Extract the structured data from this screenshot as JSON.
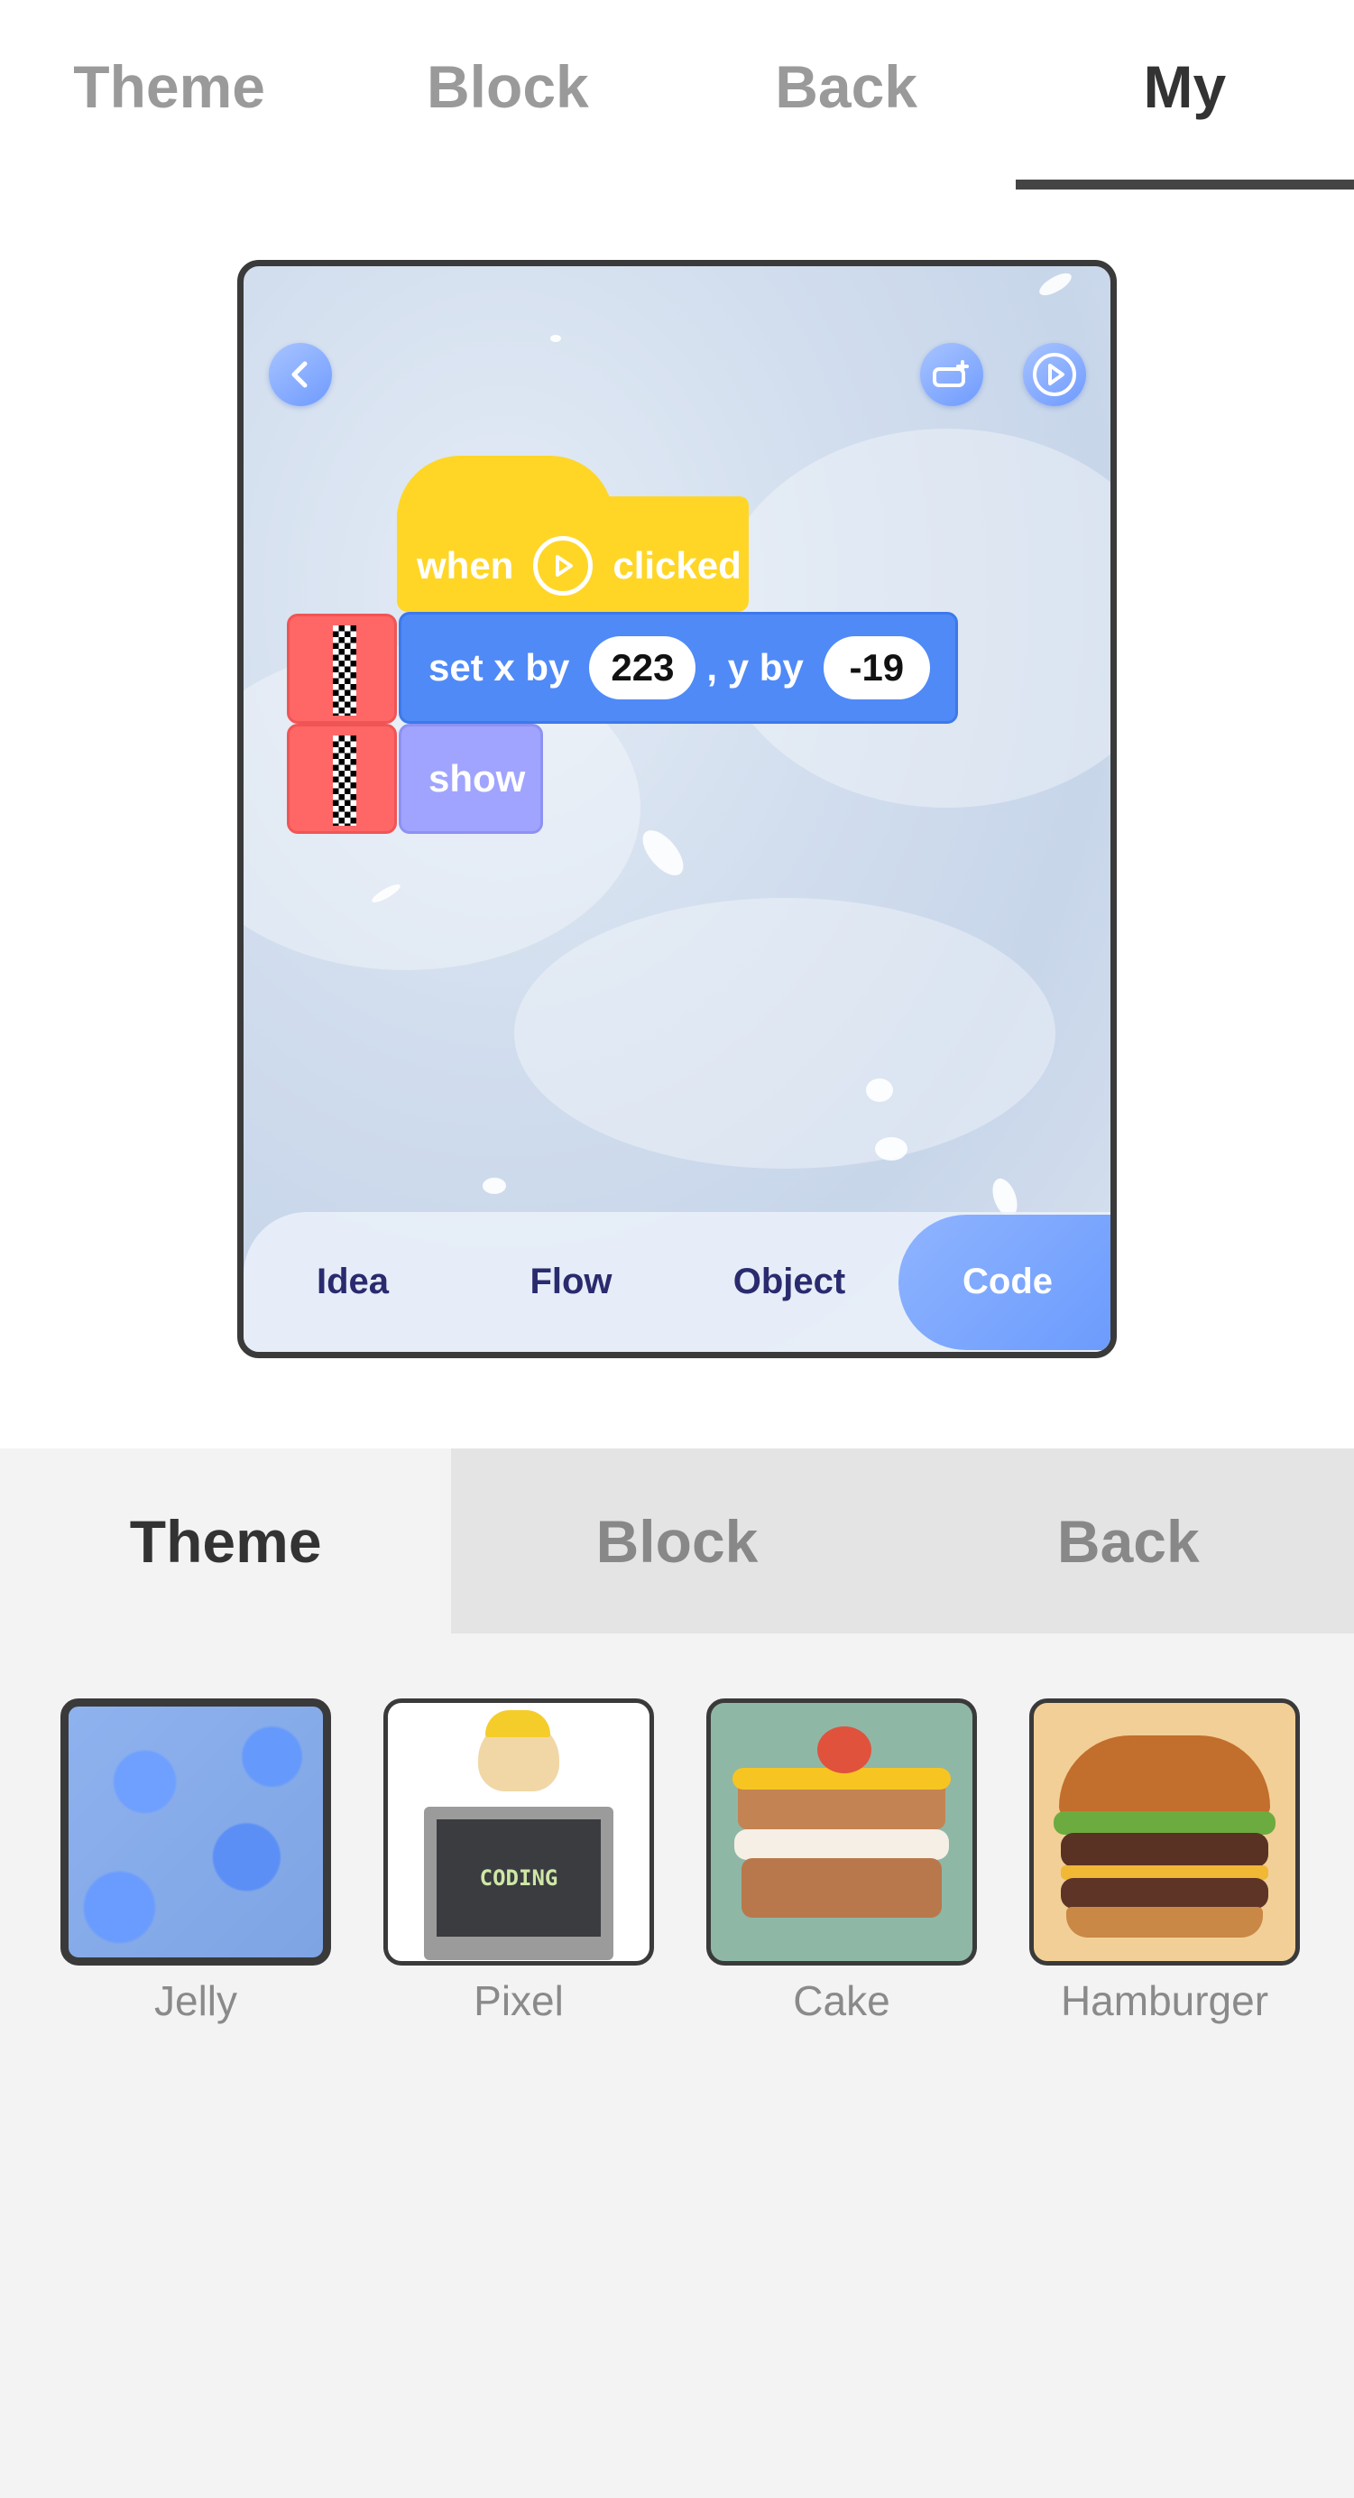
{
  "top_tabs": [
    {
      "label": "Theme"
    },
    {
      "label": "Block"
    },
    {
      "label": "Back"
    },
    {
      "label": "My",
      "active": true
    }
  ],
  "preview": {
    "icons": {
      "back": "chevron-left-icon",
      "stage": "stage-add-icon",
      "play": "play-icon"
    },
    "hat_block": {
      "before": "when",
      "icon": "play-icon",
      "after": "clicked"
    },
    "motion_block": {
      "label1": "set x by",
      "x_value": "223",
      "label2": ", y by",
      "y_value": "-19"
    },
    "looks_block": {
      "label": "show"
    },
    "bottom_tabs": [
      {
        "label": "Idea"
      },
      {
        "label": "Flow"
      },
      {
        "label": "Object"
      },
      {
        "label": "Code",
        "active": true
      }
    ]
  },
  "lower_tabs": [
    {
      "label": "Theme",
      "active": true
    },
    {
      "label": "Block"
    },
    {
      "label": "Back"
    }
  ],
  "themes": [
    {
      "label": "Jelly",
      "selected": true
    },
    {
      "label": "Pixel",
      "thumb_text": "CODING"
    },
    {
      "label": "Cake"
    },
    {
      "label": "Hamburger"
    }
  ],
  "colors": {
    "hat_block": "#ffd626",
    "motion_block": "#4f8af7",
    "looks_block": "#a0a4ff",
    "tag_block": "#ff6666",
    "accent": "#6b9bfd"
  }
}
